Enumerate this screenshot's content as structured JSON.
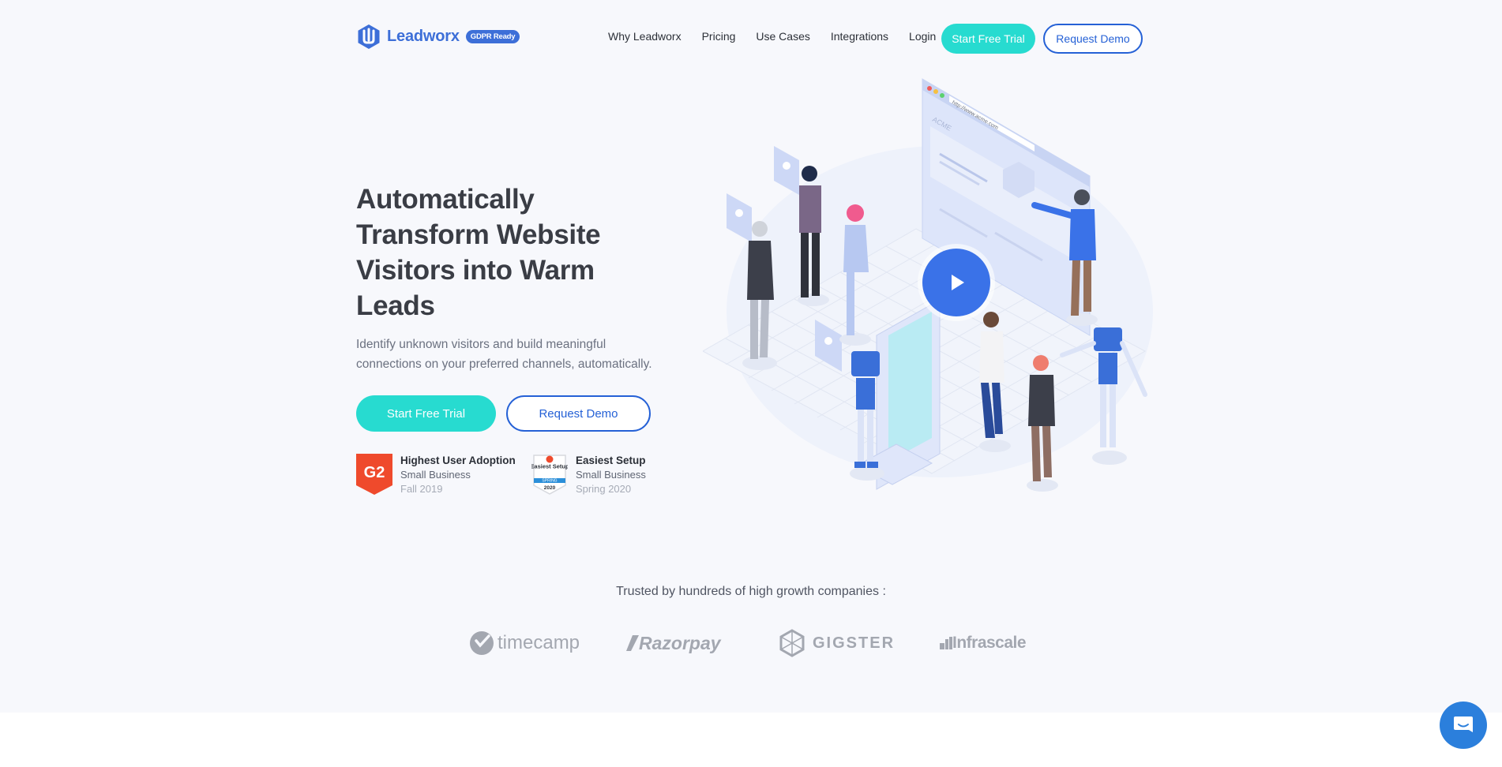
{
  "nav": {
    "logo_text": "Leadworx",
    "badge": "GDPR Ready",
    "links": [
      "Why Leadworx",
      "Pricing",
      "Use Cases",
      "Integrations",
      "Login"
    ],
    "trial_label": "Start Free Trial",
    "demo_label": "Request Demo"
  },
  "hero": {
    "title": "Automatically Transform Website Visitors into Warm Leads",
    "subtitle": "Identify unknown visitors and build meaningful connections on your preferred channels, automatically.",
    "trial_label": "Start Free Trial",
    "demo_label": "Request Demo",
    "illustration_url": "http://www.acme.com",
    "illustration_brand": "ACME"
  },
  "awards": [
    {
      "badge_text": "G2",
      "title": "Highest User Adoption",
      "segment": "Small Business",
      "season": "Fall 2019"
    },
    {
      "badge_text": "Easiest Setup",
      "badge_season": "SPRING",
      "badge_year": "2020",
      "title": "Easiest Setup",
      "segment": "Small Business",
      "season": "Spring 2020"
    }
  ],
  "trusted": {
    "heading": "Trusted by hundreds of high growth companies :",
    "brands": [
      "timecamp",
      "Razorpay",
      "GIGSTER",
      "Infrascale"
    ]
  },
  "colors": {
    "brand_blue": "#3d6fd8",
    "accent_teal": "#27dbd0",
    "demo_blue": "#2561d6",
    "play_blue": "#3a72e8",
    "chat_blue": "#2b7fdc"
  },
  "icons": {
    "logo": "leadworx-logo-icon",
    "play": "play-icon",
    "chat": "chat-icon"
  }
}
